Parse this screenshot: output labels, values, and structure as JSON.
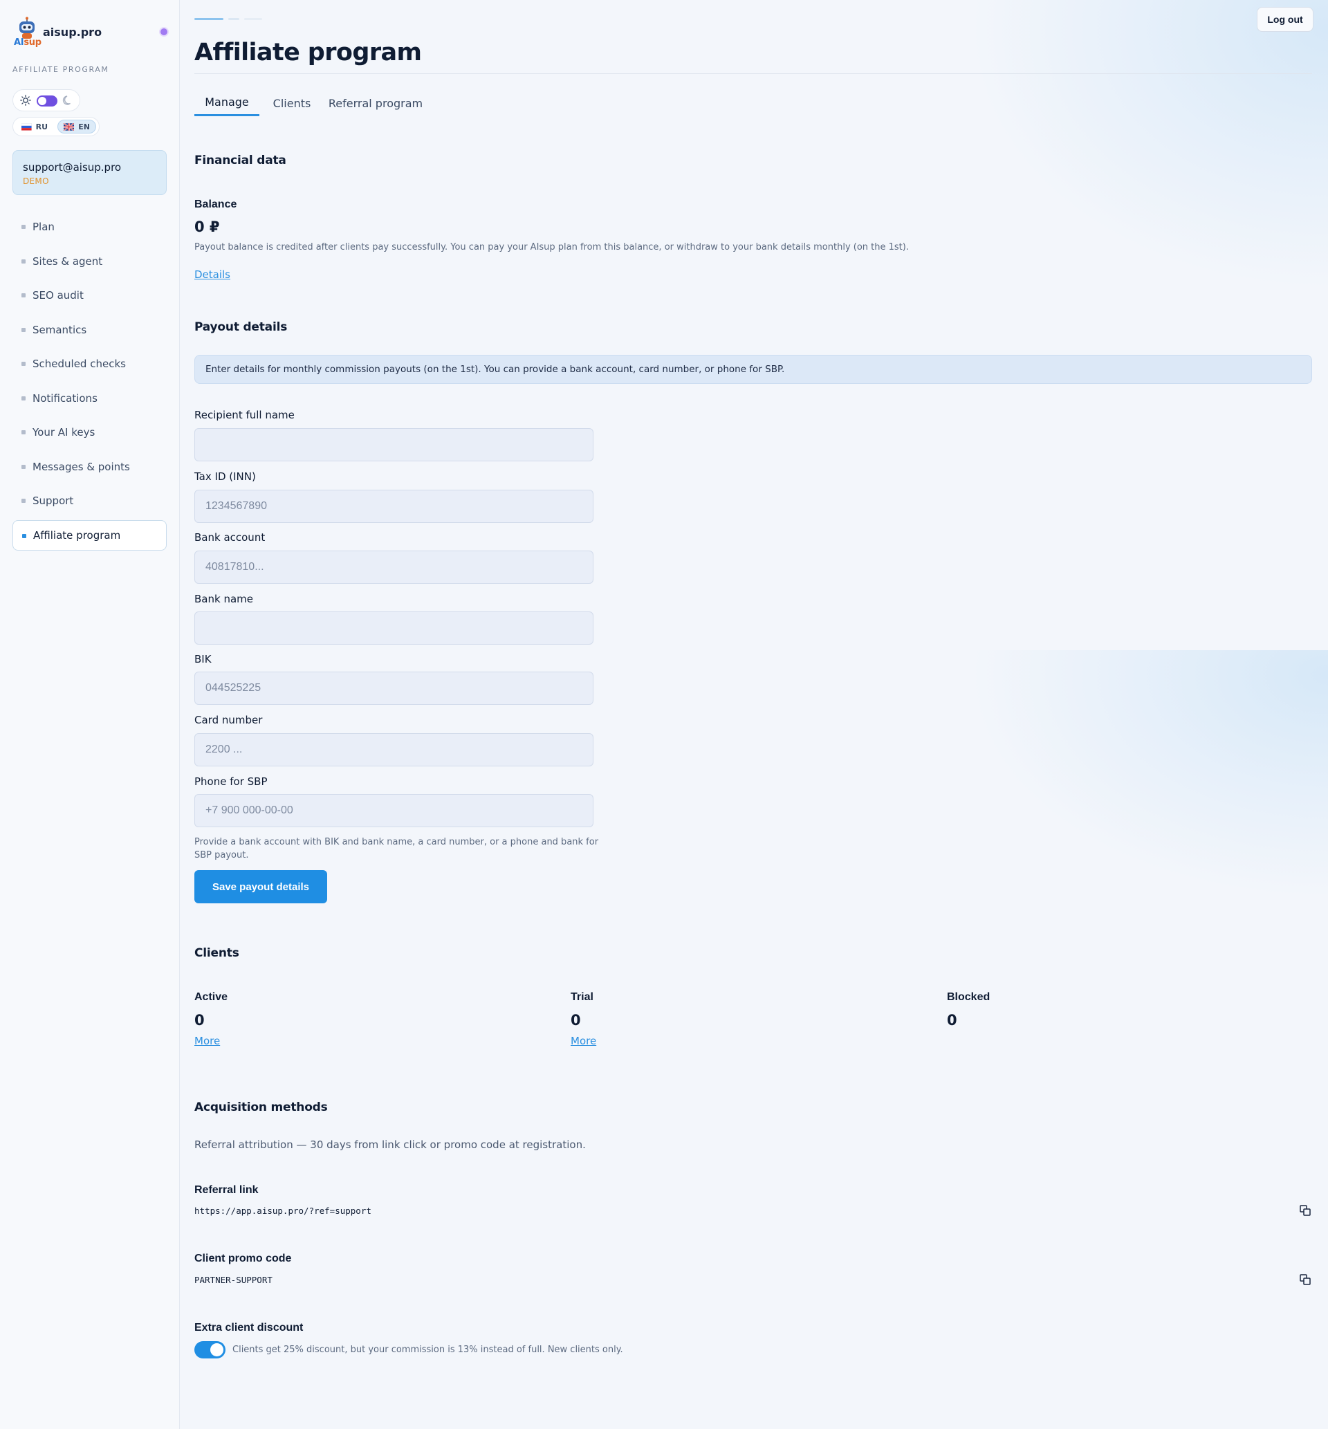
{
  "sidebar": {
    "brand_name": "aisup.pro",
    "logo_word_a": "AI",
    "logo_word_b": "sup",
    "section_caption": "AFFILIATE PROGRAM",
    "languages": [
      {
        "code": "RU",
        "selected": false
      },
      {
        "code": "EN",
        "selected": true
      }
    ],
    "theme": "light",
    "account": {
      "email": "support@aisup.pro",
      "plan": "DEMO"
    },
    "items": [
      {
        "label": "Plan"
      },
      {
        "label": "Sites & agent"
      },
      {
        "label": "SEO audit"
      },
      {
        "label": "Semantics"
      },
      {
        "label": "Scheduled checks"
      },
      {
        "label": "Notifications"
      },
      {
        "label": "Your AI keys"
      },
      {
        "label": "Messages & points"
      },
      {
        "label": "Support"
      },
      {
        "label": "Affiliate program",
        "active": true
      }
    ]
  },
  "header": {
    "logout_label": "Log out",
    "title": "Affiliate program"
  },
  "tabs": [
    {
      "label": "Manage",
      "active": true
    },
    {
      "label": "Clients"
    },
    {
      "label": "Referral program"
    }
  ],
  "financial": {
    "title": "Financial data",
    "balance_label": "Balance",
    "balance_value": "0 ₽",
    "balance_hint": "Payout balance is credited after clients pay successfully. You can pay your AIsup plan from this balance, or withdraw to your bank details monthly (on the 1st).",
    "details_link": "Details"
  },
  "payout": {
    "title": "Payout details",
    "info": "Enter details for monthly commission payouts (on the 1st). You can provide a bank account, card number, or phone for SBP.",
    "fields": [
      {
        "label": "Recipient full name",
        "placeholder": "",
        "value": ""
      },
      {
        "label": "Tax ID (INN)",
        "placeholder": "1234567890",
        "value": ""
      },
      {
        "label": "Bank account",
        "placeholder": "40817810...",
        "value": ""
      },
      {
        "label": "Bank name",
        "placeholder": "",
        "value": ""
      },
      {
        "label": "BIK",
        "placeholder": "044525225",
        "value": ""
      },
      {
        "label": "Card number",
        "placeholder": "2200 ...",
        "value": ""
      },
      {
        "label": "Phone for SBP",
        "placeholder": "+7 900 000-00-00",
        "value": ""
      }
    ],
    "hint_line1": "Provide a bank account with BIK and bank name, a card number, or a phone and bank for",
    "hint_line2": "SBP payout.",
    "save_label": "Save payout details"
  },
  "clients": {
    "title": "Clients",
    "stats": [
      {
        "label": "Active",
        "value": "0",
        "link": "More"
      },
      {
        "label": "Trial",
        "value": "0",
        "link": "More"
      },
      {
        "label": "Blocked",
        "value": "0"
      }
    ]
  },
  "acquisition": {
    "title": "Acquisition methods",
    "description": "Referral attribution — 30 days from link click or promo code at registration.",
    "referral_link_label": "Referral link",
    "referral_link": "https://app.aisup.pro/?ref=support",
    "promo_label": "Client promo code",
    "promo_code": "PARTNER-SUPPORT",
    "discount_label": "Extra client discount",
    "discount_enabled": true,
    "discount_hint": "Clients get 25% discount, but your commission is 13% instead of full. New clients only."
  },
  "colors": {
    "accent": "#1f8ee3",
    "demo_tag": "#e0912a",
    "theme_switch": "#6f4fe0",
    "status_dot": "#a17bf2"
  },
  "icons": [
    "robot-logo-icon",
    "sun-icon",
    "moon-icon",
    "ru-flag-icon",
    "uk-flag-icon",
    "copy-icon"
  ]
}
